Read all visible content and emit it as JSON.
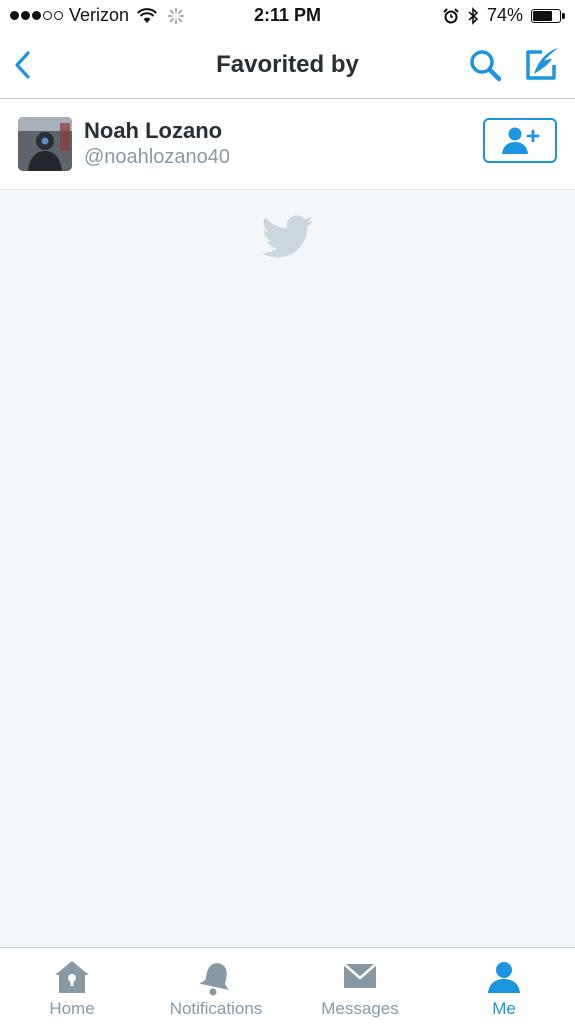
{
  "status_bar": {
    "carrier": "Verizon",
    "time": "2:11 PM",
    "battery": "74%",
    "battery_level": 0.74,
    "signal_bars": 3,
    "signal_total": 5
  },
  "nav": {
    "title": "Favorited by",
    "back_icon": "chevron-left-icon",
    "search_icon": "search-icon",
    "compose_icon": "compose-icon"
  },
  "users": [
    {
      "name": "Noah Lozano",
      "handle": "@noahlozano40"
    }
  ],
  "tabs": [
    {
      "label": "Home",
      "icon": "home-icon",
      "active": false
    },
    {
      "label": "Notifications",
      "icon": "bell-icon",
      "active": false
    },
    {
      "label": "Messages",
      "icon": "envelope-icon",
      "active": false
    },
    {
      "label": "Me",
      "icon": "person-icon",
      "active": true
    }
  ],
  "colors": {
    "accent": "#1b95e0",
    "muted": "#8899a6",
    "text": "#292f33",
    "background": "#f4f7fa",
    "bird": "#ccd6dd"
  }
}
